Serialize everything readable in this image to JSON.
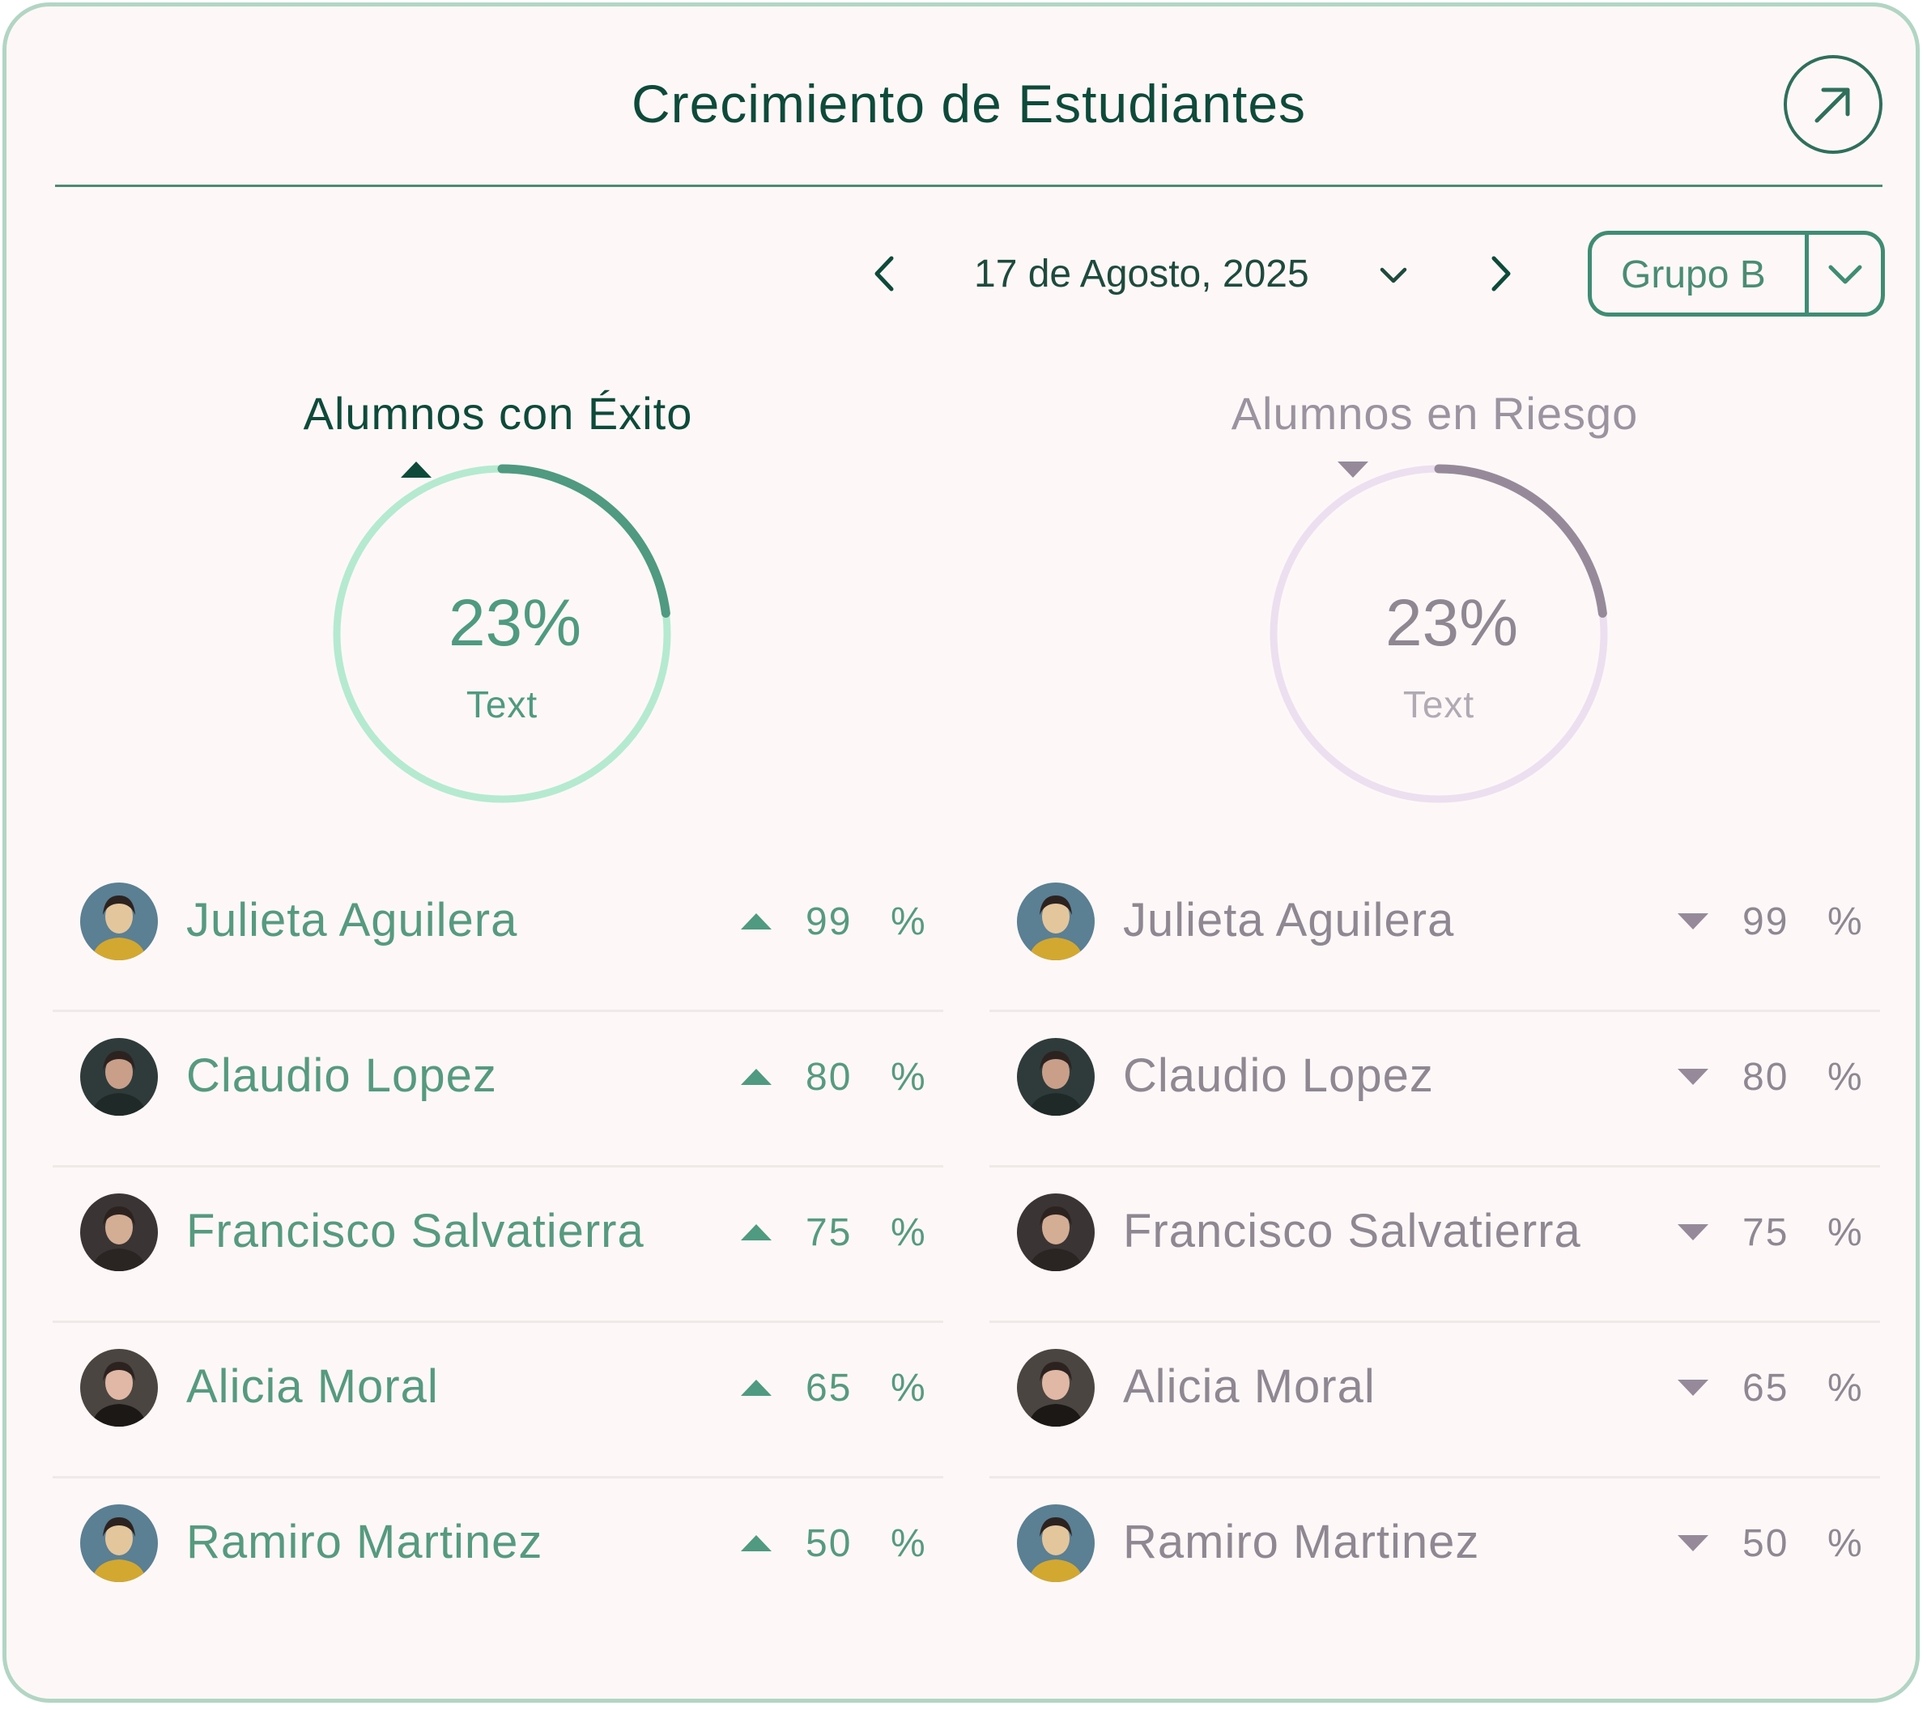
{
  "header": {
    "title": "Crecimiento de Estudiantes",
    "expand_icon": "arrow-up-right-icon"
  },
  "nav": {
    "date": "17 de Agosto, 2025",
    "prev_icon": "chevron-left-icon",
    "next_icon": "chevron-right-icon",
    "date_dropdown_icon": "chevron-down-icon",
    "group": "Grupo B",
    "group_dropdown_icon": "chevron-down-icon"
  },
  "success": {
    "title": "Alumnos con Éxito",
    "gauge_value": "23%",
    "gauge_fraction": 0.23,
    "gauge_caption": "Text",
    "trend": "up",
    "colors": {
      "title": "#0e4a3a",
      "track": "#b5ead0",
      "arc": "#4f9a80",
      "value": "#4f9a80",
      "arrow": "#0e4a3a",
      "caption": "#4f9a80"
    },
    "students": [
      {
        "name": "Julieta Aguilera",
        "value": "99",
        "unit": "%"
      },
      {
        "name": "Claudio Lopez",
        "value": "80",
        "unit": "%"
      },
      {
        "name": "Francisco Salvatierra",
        "value": "75",
        "unit": "%"
      },
      {
        "name": "Alicia Moral",
        "value": "65",
        "unit": "%"
      },
      {
        "name": "Ramiro Martinez",
        "value": "50",
        "unit": "%"
      }
    ]
  },
  "risk": {
    "title": "Alumnos en Riesgo",
    "gauge_value": "23%",
    "gauge_fraction": 0.23,
    "gauge_caption": "Text",
    "trend": "down",
    "colors": {
      "title": "#9b93a0",
      "track": "#ecdff0",
      "arc": "#968a9a",
      "value": "#8f8792",
      "arrow": "#968a9a",
      "caption": "#b1aab4"
    },
    "students": [
      {
        "name": "Julieta Aguilera",
        "value": "99",
        "unit": "%"
      },
      {
        "name": "Claudio Lopez",
        "value": "80",
        "unit": "%"
      },
      {
        "name": "Francisco Salvatierra",
        "value": "75",
        "unit": "%"
      },
      {
        "name": "Alicia Moral",
        "value": "65",
        "unit": "%"
      },
      {
        "name": "Ramiro Martinez",
        "value": "50",
        "unit": "%"
      }
    ]
  }
}
